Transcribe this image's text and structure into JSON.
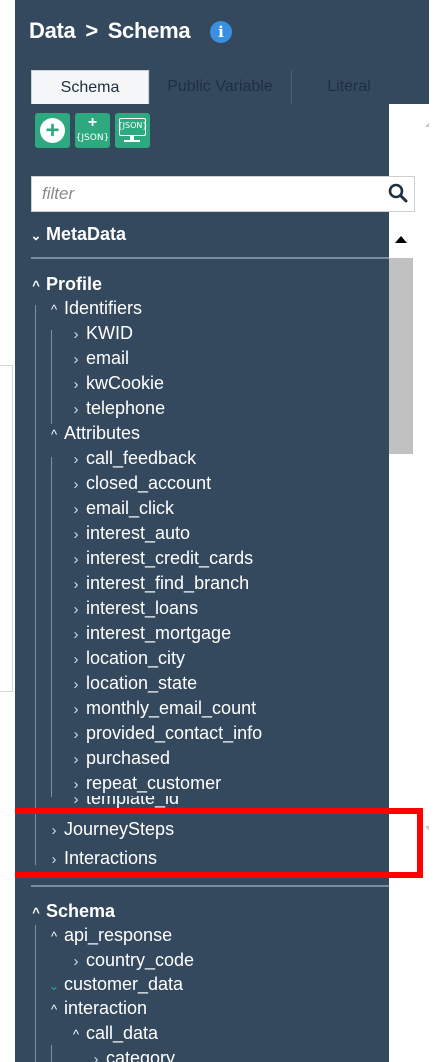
{
  "header": {
    "crumb": "Data",
    "sep": ">",
    "page": "Schema",
    "info": "i"
  },
  "tabs": [
    {
      "label": "Schema",
      "active": true
    },
    {
      "label": "Public Variable"
    },
    {
      "label": "Literal"
    }
  ],
  "toolbar": {
    "add_json_text": "{JSON}",
    "view_json_text": "{JSON}"
  },
  "filter": {
    "placeholder": "filter"
  },
  "tree": {
    "metadata": "MetaData",
    "profile": "Profile",
    "identifiers": "Identifiers",
    "identifier_items": [
      "KWID",
      "email",
      "kwCookie",
      "telephone"
    ],
    "attributes": "Attributes",
    "attribute_items": [
      "call_feedback",
      "closed_account",
      "email_click",
      "interest_auto",
      "interest_credit_cards",
      "interest_find_branch",
      "interest_loans",
      "interest_mortgage",
      "location_city",
      "location_state",
      "monthly_email_count",
      "provided_contact_info",
      "purchased",
      "repeat_customer",
      "template_id"
    ],
    "journey_steps": "JourneySteps",
    "interactions": "Interactions",
    "schema": "Schema",
    "api_response": "api_response",
    "country_code": "country_code",
    "customer_data": "customer_data",
    "interaction": "interaction",
    "call_data": "call_data",
    "category": "category"
  },
  "colors": {
    "panel": "#34495e",
    "accent": "#2ea87e",
    "info": "#3b8fe0",
    "highlight": "#ff0000"
  },
  "icons": [
    "info-icon",
    "add-circle-icon",
    "add-json-icon",
    "view-json-icon",
    "search-icon",
    "chevron-down-icon",
    "chevron-up-icon",
    "chevron-right-icon"
  ]
}
